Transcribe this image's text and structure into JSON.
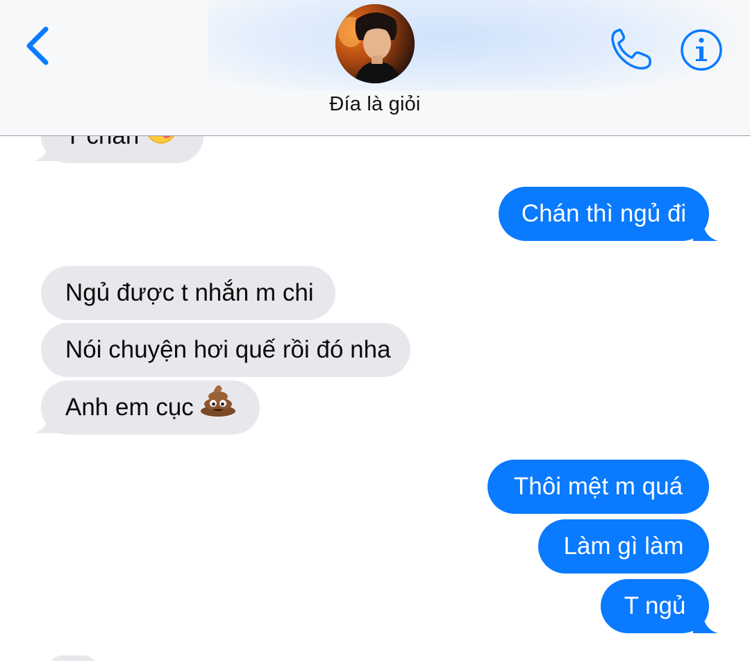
{
  "header": {
    "contact_name": "Đía là giỏi",
    "back_icon": "chevron-left-icon",
    "call_icon": "phone-icon",
    "info_icon": "info-icon",
    "accent_color": "#0a7aff"
  },
  "messages": [
    {
      "direction": "incoming",
      "text": "T chán",
      "emoji": "face-savoring-food-icon",
      "partially_hidden": true
    },
    {
      "direction": "outgoing",
      "text": "Chán thì ngủ đi"
    },
    {
      "direction": "incoming",
      "text": "Ngủ được t nhắn m chi"
    },
    {
      "direction": "incoming",
      "text": "Nói chuyện hơi quế rồi đó nha"
    },
    {
      "direction": "incoming",
      "text": "Anh em cục",
      "emoji": "pile-of-poo-icon"
    },
    {
      "direction": "outgoing",
      "text": "Thôi mệt m quá"
    },
    {
      "direction": "outgoing",
      "text": "Làm gì làm"
    },
    {
      "direction": "outgoing",
      "text": "T ngủ"
    }
  ],
  "colors": {
    "incoming_bubble": "#e8e8ec",
    "outgoing_bubble": "#0a7aff",
    "header_background": "#f7f8fa"
  }
}
